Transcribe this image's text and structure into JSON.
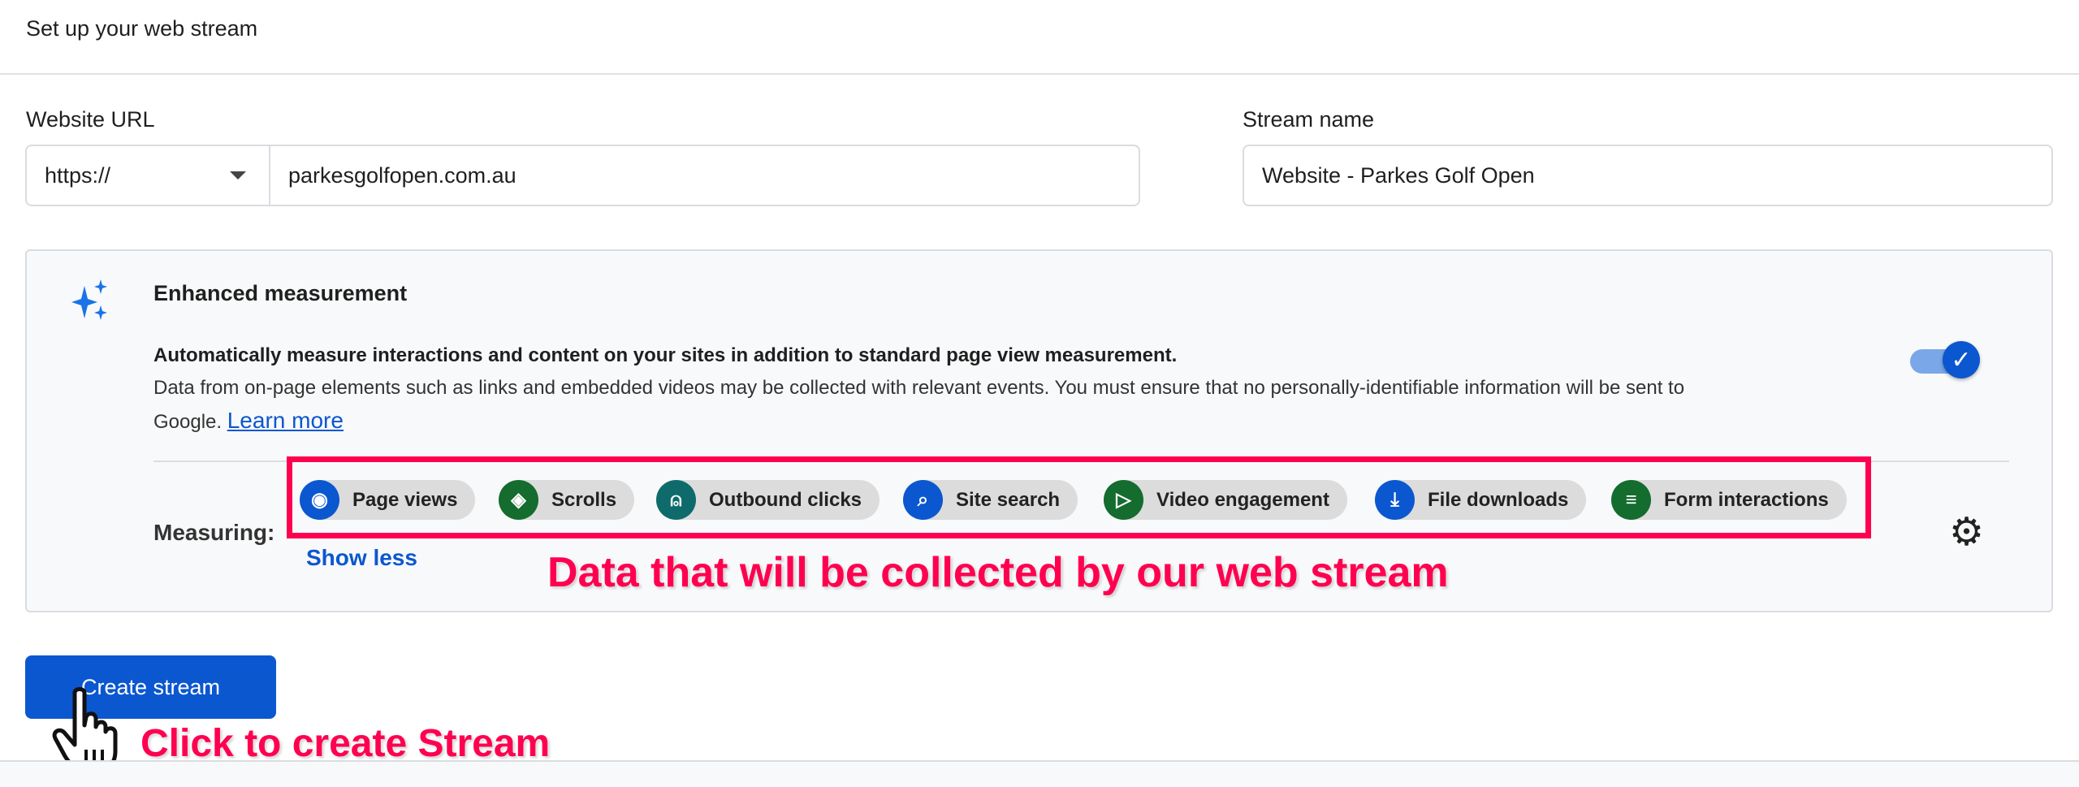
{
  "header": {
    "title": "Set up your web stream"
  },
  "form": {
    "website_url_label": "Website URL",
    "protocol_value": "https://",
    "url_value": "parkesgolfopen.com.au",
    "stream_name_label": "Stream name",
    "stream_name_value": "Website - Parkes Golf Open"
  },
  "enhanced": {
    "title": "Enhanced measurement",
    "line1": "Automatically measure interactions and content on your sites in addition to standard page view measurement.",
    "line2": "Data from on-page elements such as links and embedded videos may be collected with relevant events. You must ensure that no personally-identifiable information will be sent to",
    "line3": "Google.",
    "learn_more": "Learn more",
    "toggle_on": true,
    "measuring_label": "Measuring:",
    "show_less": "Show less",
    "chips": [
      {
        "label": "Page views",
        "icon": "eye-icon",
        "color": "#0b57d0"
      },
      {
        "label": "Scrolls",
        "icon": "scroll-arrows-icon",
        "color": "#146c2e"
      },
      {
        "label": "Outbound clicks",
        "icon": "mouse-icon",
        "color": "#0f6b6b"
      },
      {
        "label": "Site search",
        "icon": "search-icon",
        "color": "#0b57d0"
      },
      {
        "label": "Video engagement",
        "icon": "play-icon",
        "color": "#146c2e"
      },
      {
        "label": "File downloads",
        "icon": "download-icon",
        "color": "#0b57d0"
      },
      {
        "label": "Form interactions",
        "icon": "playlist-add-icon",
        "color": "#146c2e"
      }
    ]
  },
  "annotations": {
    "data_note": "Data that will be collected by our web stream",
    "click_note": "Click to create Stream"
  },
  "actions": {
    "create_stream": "Create stream"
  },
  "colors": {
    "primary": "#0b57d0",
    "annotation": "#ff0050"
  }
}
